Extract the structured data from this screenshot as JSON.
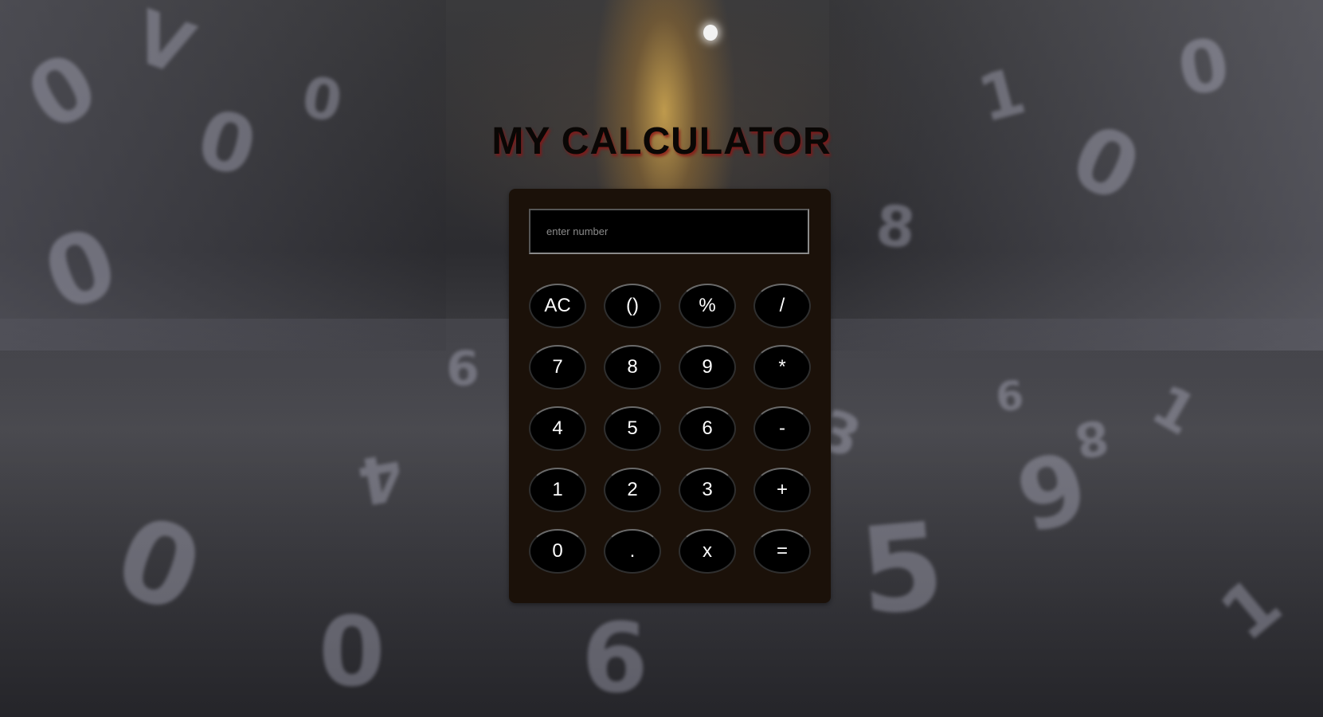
{
  "page": {
    "title": "MY CALCULATOR"
  },
  "display": {
    "value": "",
    "placeholder": "enter number"
  },
  "keys": [
    {
      "label": "AC",
      "name": "clear-button"
    },
    {
      "label": "()",
      "name": "parentheses-button"
    },
    {
      "label": "%",
      "name": "percent-button"
    },
    {
      "label": "/",
      "name": "divide-button"
    },
    {
      "label": "7",
      "name": "digit-7-button"
    },
    {
      "label": "8",
      "name": "digit-8-button"
    },
    {
      "label": "9",
      "name": "digit-9-button"
    },
    {
      "label": "*",
      "name": "multiply-button"
    },
    {
      "label": "4",
      "name": "digit-4-button"
    },
    {
      "label": "5",
      "name": "digit-5-button"
    },
    {
      "label": "6",
      "name": "digit-6-button"
    },
    {
      "label": "-",
      "name": "subtract-button"
    },
    {
      "label": "1",
      "name": "digit-1-button"
    },
    {
      "label": "2",
      "name": "digit-2-button"
    },
    {
      "label": "3",
      "name": "digit-3-button"
    },
    {
      "label": "+",
      "name": "add-button"
    },
    {
      "label": "0",
      "name": "digit-0-button"
    },
    {
      "label": ".",
      "name": "decimal-button"
    },
    {
      "label": "x",
      "name": "x-button"
    },
    {
      "label": "=",
      "name": "equals-button"
    }
  ],
  "colors": {
    "panel": "#1b1109",
    "key": "#000000",
    "title": "#0a0705",
    "title_shadow": "#8c1414"
  }
}
